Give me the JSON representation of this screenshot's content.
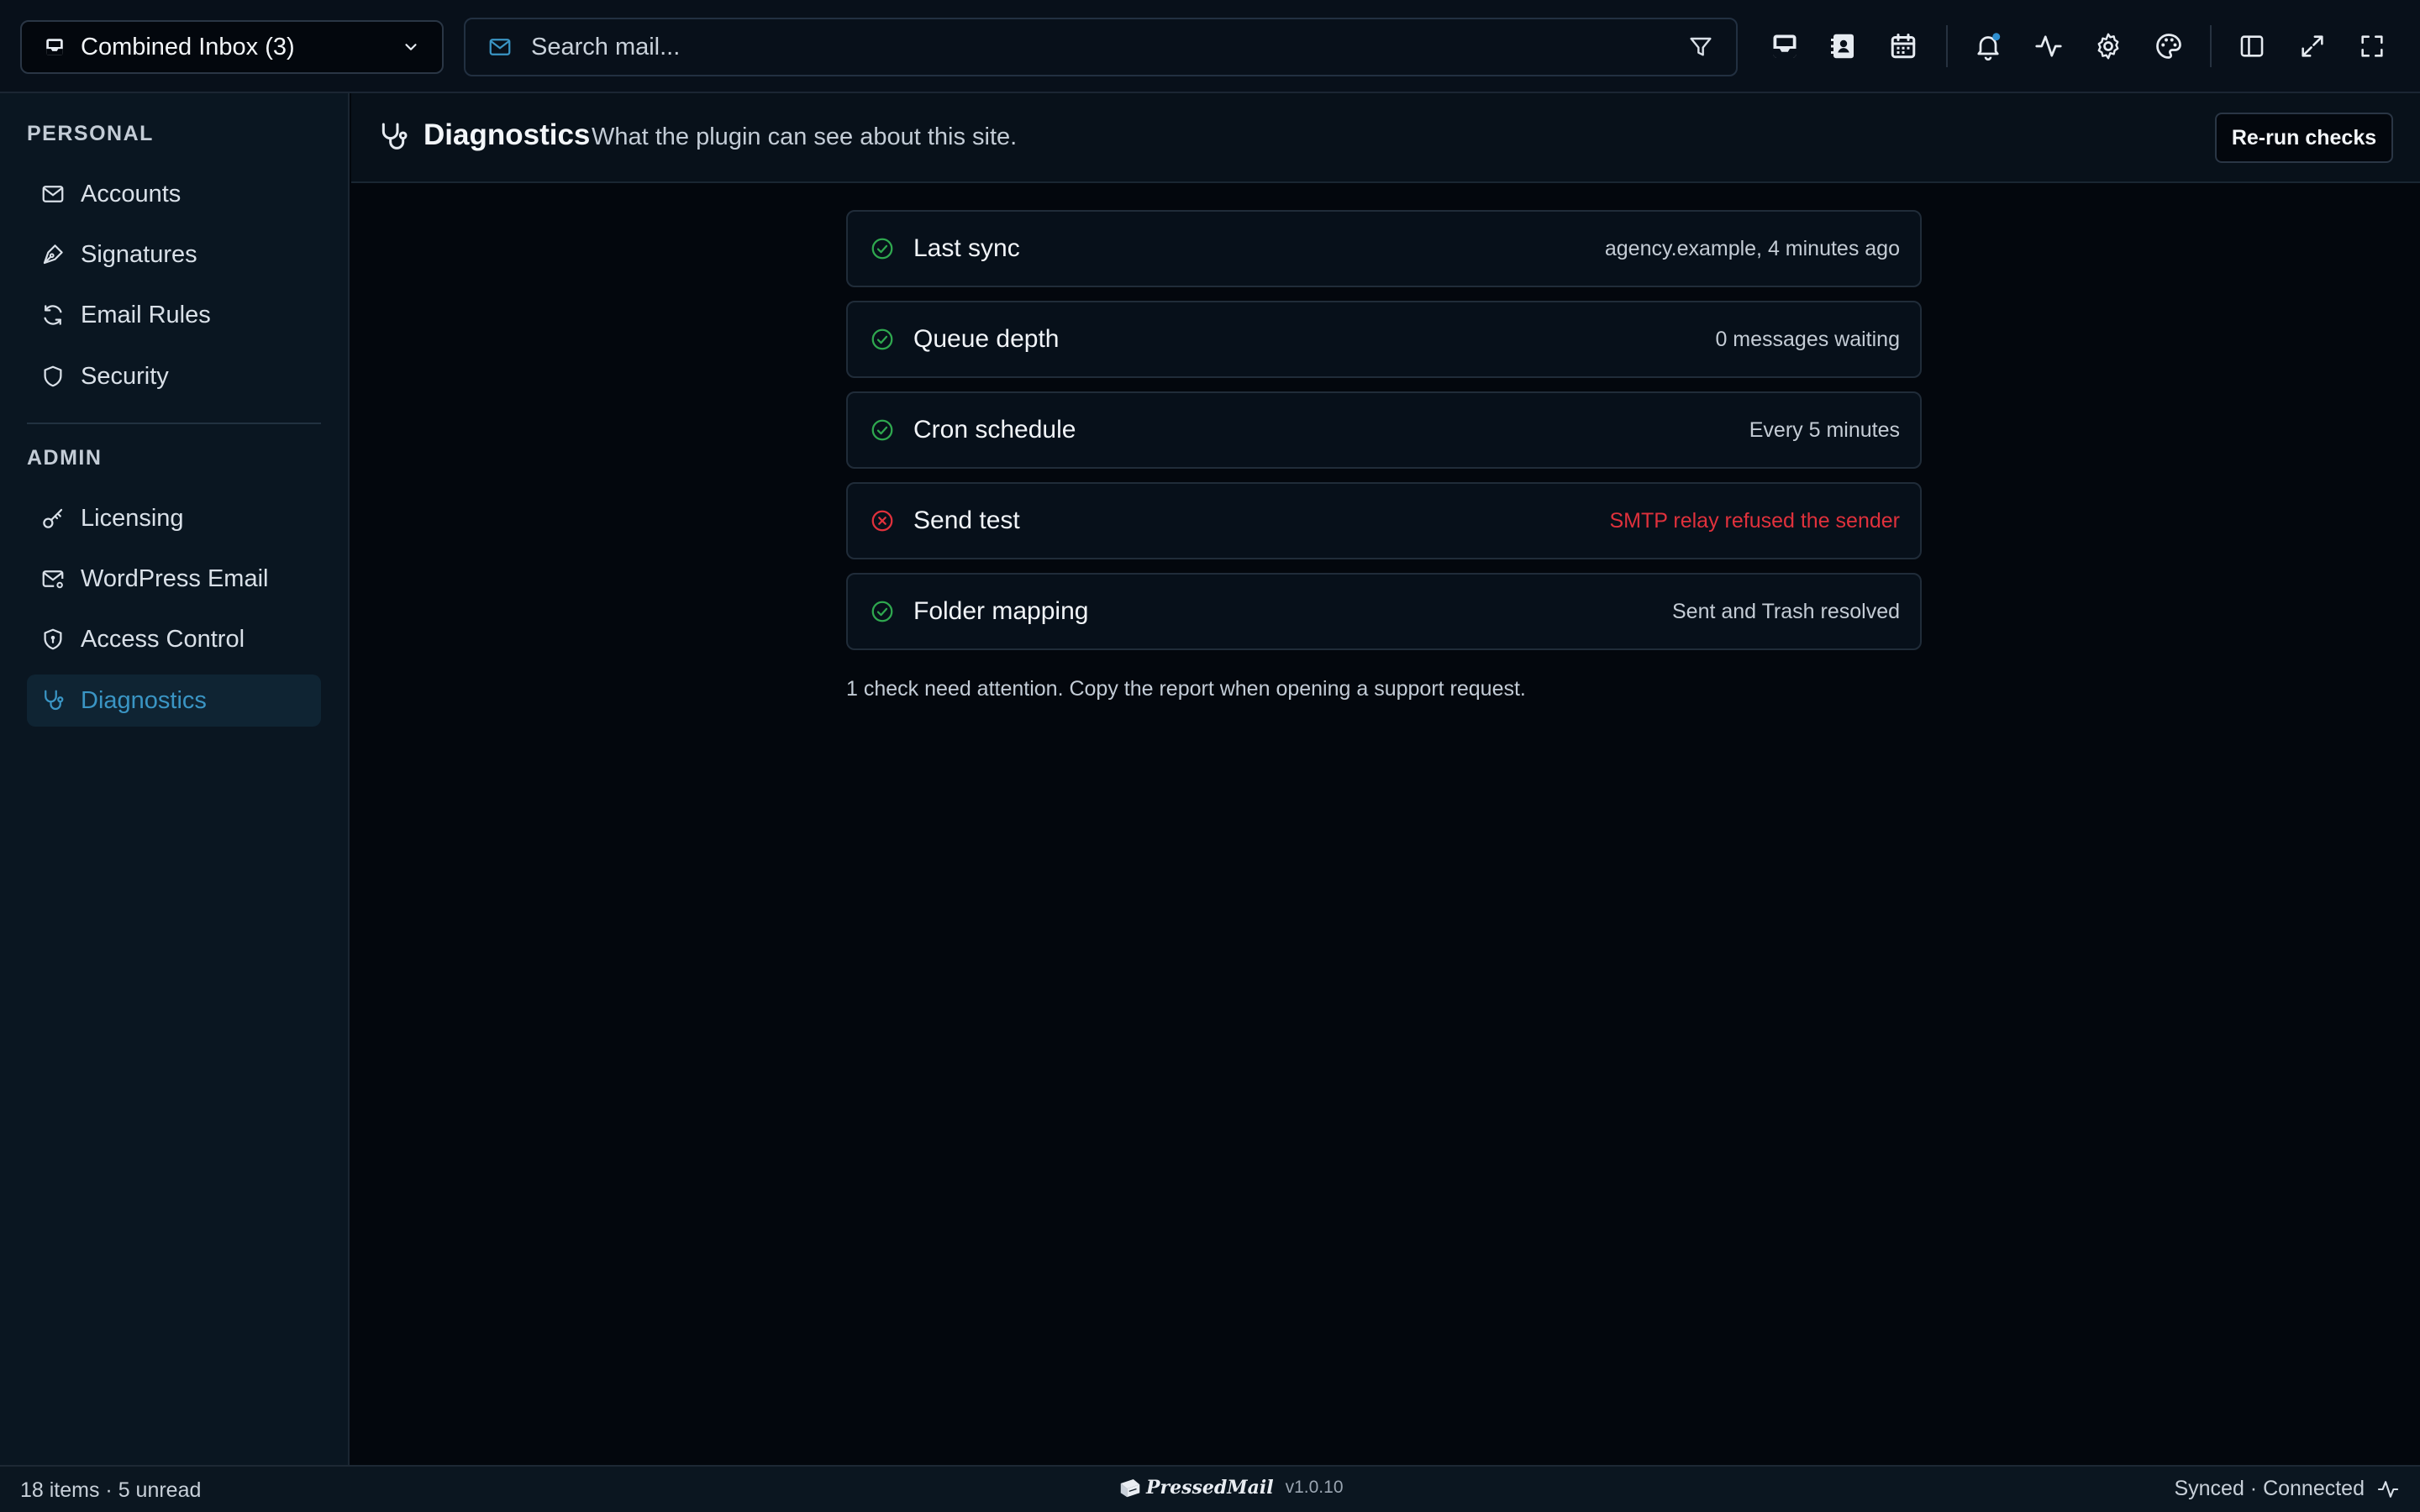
{
  "topbar": {
    "inbox_label": "Combined Inbox (3)",
    "search_placeholder": "Search mail...",
    "icons": [
      "inbox-icon",
      "contacts-icon",
      "calendar-icon",
      "bell-icon",
      "activity-icon",
      "gear-icon",
      "palette-icon",
      "sidebar-toggle-icon",
      "expand-icon",
      "fullscreen-icon"
    ],
    "notification_dot_color": "#2f8fd0"
  },
  "sidebar": {
    "personal_title": "PERSONAL",
    "personal_items": [
      {
        "label": "Accounts",
        "icon": "mail-icon"
      },
      {
        "label": "Signatures",
        "icon": "pen-nib-icon"
      },
      {
        "label": "Email Rules",
        "icon": "refresh-icon"
      },
      {
        "label": "Security",
        "icon": "shield-icon"
      }
    ],
    "admin_title": "ADMIN",
    "admin_items": [
      {
        "label": "Licensing",
        "icon": "key-icon"
      },
      {
        "label": "WordPress Email",
        "icon": "mail-settings-icon"
      },
      {
        "label": "Access Control",
        "icon": "shield-lock-icon"
      },
      {
        "label": "Diagnostics",
        "icon": "stethoscope-icon",
        "active": true
      }
    ]
  },
  "main": {
    "title": "Diagnostics",
    "subtitle": "What the plugin can see about this site.",
    "rerun_label": "Re-run checks",
    "checks": [
      {
        "name": "Last sync",
        "detail": "agency.example, 4 minutes ago",
        "status": "ok"
      },
      {
        "name": "Queue depth",
        "detail": "0 messages waiting",
        "status": "ok"
      },
      {
        "name": "Cron schedule",
        "detail": "Every 5 minutes",
        "status": "ok"
      },
      {
        "name": "Send test",
        "detail": "SMTP relay refused the sender",
        "status": "error"
      },
      {
        "name": "Folder mapping",
        "detail": "Sent and Trash resolved",
        "status": "ok"
      }
    ],
    "footnote": "1 check need attention. Copy the report when opening a support request."
  },
  "statusbar": {
    "counts": "18 items · 5 unread",
    "brand": "PressedMail",
    "version": "v1.0.10",
    "sync_status": "Synced · Connected"
  },
  "colors": {
    "accent": "#3a95c4",
    "ok": "#2fa84f",
    "error": "#e0313c"
  }
}
